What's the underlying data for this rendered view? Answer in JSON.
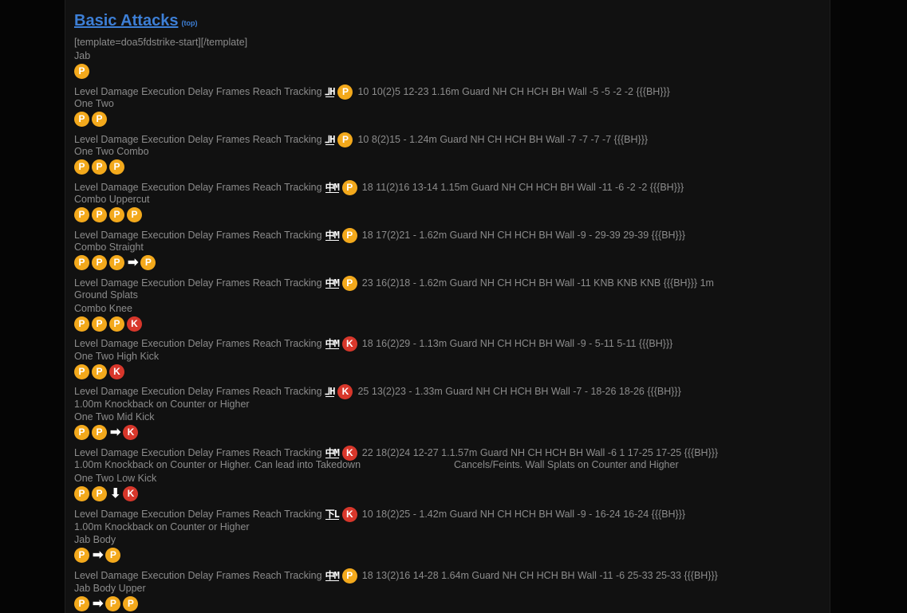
{
  "header": {
    "title": "Basic Attacks",
    "top_link": "(top)"
  },
  "template_text": "[template=doa5fdstrike-start][/template]",
  "moves": [
    {
      "name": "Jab",
      "inputs": [
        "P"
      ],
      "level": "⅃H",
      "button": "P",
      "stats": "10 10(2)5 12-23 1.16m Guard NH CH HCH BH Wall -5 -5 -2 -2 {{{BH}}}",
      "notes": []
    },
    {
      "name": "One Two",
      "inputs": [
        "P",
        "P"
      ],
      "level": "⅃H",
      "button": "P",
      "stats": "10 8(2)15 - 1.24m Guard NH CH HCH BH Wall -7 -7 -7 -7 {{{BH}}}",
      "notes": []
    },
    {
      "name": "One Two Combo",
      "inputs": [
        "P",
        "P",
        "P"
      ],
      "level": "中M",
      "button": "P",
      "stats": "18 11(2)16 13-14 1.15m Guard NH CH HCH BH Wall -11 -6 -2 -2 {{{BH}}}",
      "notes": []
    },
    {
      "name": "Combo Uppercut",
      "inputs": [
        "P",
        "P",
        "P",
        "P"
      ],
      "level": "中M",
      "button": "P",
      "stats": "18 17(2)21 - 1.62m Guard NH CH HCH BH Wall -9 - 29-39 29-39 {{{BH}}}",
      "notes": []
    },
    {
      "name": "Combo Straight",
      "inputs": [
        "P",
        "P",
        "P",
        "→",
        "P"
      ],
      "level": "中M",
      "button": "P",
      "stats": "23 16(2)18 - 1.62m Guard NH CH HCH BH Wall -11 KNB KNB KNB {{{BH}}} 1m",
      "notes": [
        "Ground Splats"
      ]
    },
    {
      "name": "Combo Knee",
      "inputs": [
        "P",
        "P",
        "P",
        "K"
      ],
      "level": "中M",
      "button": "K",
      "stats": "18 16(2)29 - 1.13m Guard NH CH HCH BH Wall -9 - 5-11 5-11 {{{BH}}}",
      "notes": []
    },
    {
      "name": "One Two High Kick",
      "inputs": [
        "P",
        "P",
        "K"
      ],
      "level": "⅃H",
      "button": "K",
      "stats": "25 13(2)23 - 1.33m Guard NH CH HCH BH Wall -7 - 18-26 18-26 {{{BH}}}",
      "notes": [
        "1.00m Knockback on Counter or Higher"
      ]
    },
    {
      "name": "One Two Mid Kick",
      "inputs": [
        "P",
        "P",
        "→",
        "K"
      ],
      "level": "中M",
      "button": "K",
      "stats": "22 18(2)24 12-27 1.1.57m Guard NH CH HCH BH Wall -6 1 17-25 17-25 {{{BH}}}",
      "notes": [
        "1.00m Knockback on Counter or Higher. Can lead into Takedown",
        "Cancels/Feints. Wall Splats on Counter and Higher"
      ]
    },
    {
      "name": "One Two Low Kick",
      "inputs": [
        "P",
        "P",
        "↓",
        "K"
      ],
      "level": "下L",
      "button": "K",
      "stats": "10 18(2)25 - 1.42m Guard NH CH HCH BH Wall -9 - 16-24 16-24 {{{BH}}}",
      "notes": [
        "1.00m Knockback on Counter or Higher"
      ]
    },
    {
      "name": "Jab Body",
      "inputs": [
        "P",
        "→",
        "P"
      ],
      "level": "中M",
      "button": "P",
      "stats": "18 13(2)16 14-28 1.64m Guard NH CH HCH BH Wall -11 -6 25-33 25-33 {{{BH}}}",
      "notes": []
    },
    {
      "name": "Jab Body Upper",
      "inputs": [
        "P",
        "→",
        "P",
        "P"
      ],
      "level": "",
      "button": "",
      "stats": "",
      "notes": []
    }
  ],
  "stat_label": "Level Damage Execution Delay Frames Reach Tracking",
  "colors": {
    "punch": "#f3a91c",
    "kick": "#d8372b",
    "link": "#3d7fd6"
  }
}
